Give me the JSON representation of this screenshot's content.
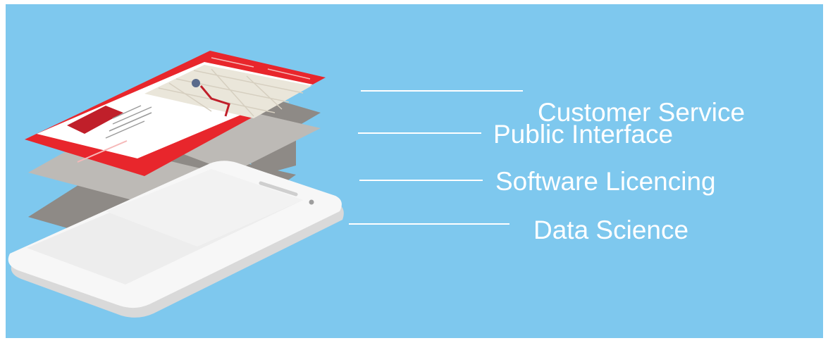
{
  "colors": {
    "background": "#7EC8EE",
    "accent_red": "#E8262C",
    "layer_dark": "#8E8A86",
    "layer_light": "#BDBAB6",
    "phone_white": "#F6F6F6"
  },
  "layers": [
    {
      "label": "Customer Service"
    },
    {
      "label": "Public Interface"
    },
    {
      "label": "Software Licencing"
    },
    {
      "label": "Data Science"
    }
  ]
}
